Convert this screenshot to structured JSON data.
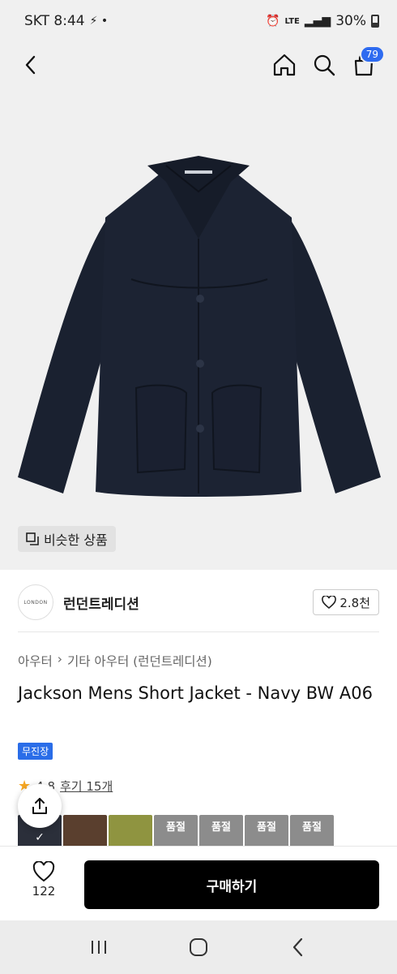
{
  "status_bar": {
    "carrier_time": "SKT 8:44",
    "battery": "30%",
    "network": "LTE"
  },
  "nav": {
    "cart_count": "79"
  },
  "hero": {
    "similar_label": "비슷한 상품",
    "image_subject": "navy short wool jacket"
  },
  "brand": {
    "logo_text": "LONDON",
    "name": "런던트레디션",
    "likes": "2.8천"
  },
  "product": {
    "breadcrumb": [
      "아우터",
      "기타 아우터 (런던트레디션)"
    ],
    "title": "Jackson Mens Short Jacket - Navy BW A06",
    "badge": "무진장",
    "rating": "4.8",
    "reviews": "후기 15개"
  },
  "variants": [
    {
      "color": "navy",
      "selected": true,
      "soldout": false
    },
    {
      "color": "brown",
      "selected": false,
      "soldout": false
    },
    {
      "color": "olive",
      "selected": false,
      "soldout": false
    },
    {
      "color": "grey",
      "selected": false,
      "soldout": true,
      "label": "품절"
    },
    {
      "color": "grey",
      "selected": false,
      "soldout": true,
      "label": "품절"
    },
    {
      "color": "grey",
      "selected": false,
      "soldout": true,
      "label": "품절"
    },
    {
      "color": "grey",
      "selected": false,
      "soldout": true,
      "label": "품절"
    }
  ],
  "bottom": {
    "wish_count": "122",
    "buy_label": "구매하기"
  },
  "colors": {
    "accent": "#2e6bf0",
    "buy_button": "#000000",
    "star": "#f5a623"
  }
}
